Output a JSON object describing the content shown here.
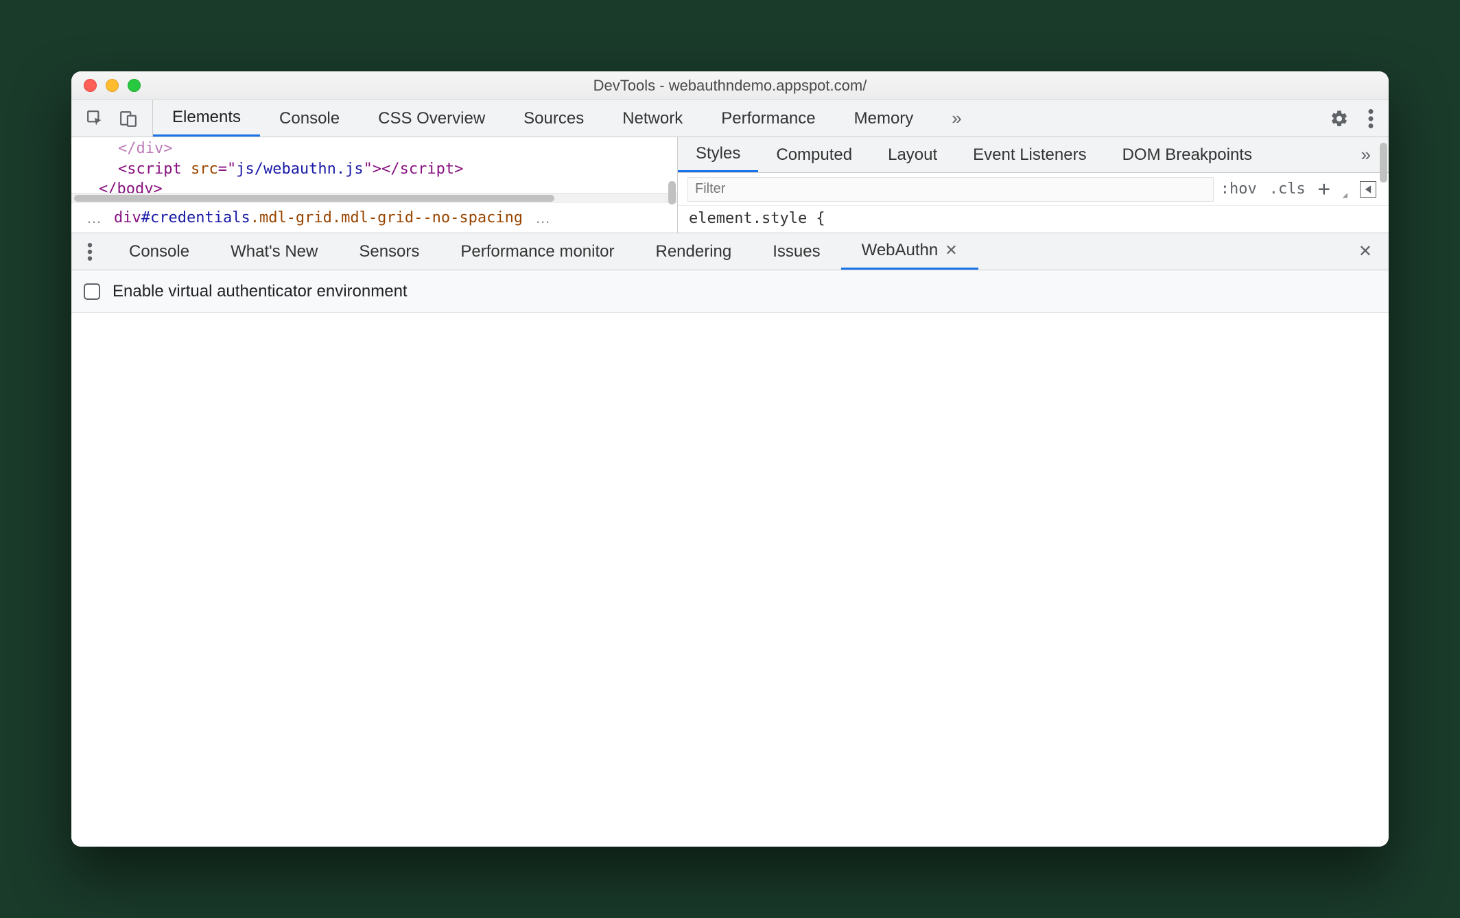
{
  "window": {
    "title": "DevTools - webauthndemo.appspot.com/"
  },
  "main_tabs": {
    "items": [
      "Elements",
      "Console",
      "CSS Overview",
      "Sources",
      "Network",
      "Performance",
      "Memory"
    ],
    "active": "Elements"
  },
  "elements": {
    "code_lines": [
      {
        "parts": [
          {
            "t": "</",
            "c": "tag"
          },
          {
            "t": "div",
            "c": "tag"
          },
          {
            "t": ">",
            "c": "tag"
          }
        ],
        "dim": true,
        "indent": 2
      },
      {
        "parts": [
          {
            "t": "<",
            "c": "tag"
          },
          {
            "t": "script ",
            "c": "tag"
          },
          {
            "t": "src",
            "c": "attr"
          },
          {
            "t": "=\"",
            "c": "tag"
          },
          {
            "t": "js/webauthn.js",
            "c": "str"
          },
          {
            "t": "\">",
            "c": "tag"
          },
          {
            "t": "</",
            "c": "tag"
          },
          {
            "t": "script",
            "c": "tag"
          },
          {
            "t": ">",
            "c": "tag"
          }
        ],
        "indent": 2
      },
      {
        "parts": [
          {
            "t": "</",
            "c": "tag"
          },
          {
            "t": "body",
            "c": "tag"
          },
          {
            "t": ">",
            "c": "tag"
          }
        ],
        "indent": 1
      }
    ],
    "breadcrumb": {
      "prefix": "…",
      "selector": {
        "tag": "div",
        "id": "#credentials",
        "classes": ".mdl-grid.mdl-grid--no-spacing"
      },
      "suffix": "…"
    }
  },
  "styles": {
    "tabs": [
      "Styles",
      "Computed",
      "Layout",
      "Event Listeners",
      "DOM Breakpoints"
    ],
    "active": "Styles",
    "filter_placeholder": "Filter",
    "tools": {
      "hov": ":hov",
      "cls": ".cls"
    },
    "body": "element.style {"
  },
  "drawer": {
    "tabs": [
      "Console",
      "What's New",
      "Sensors",
      "Performance monitor",
      "Rendering",
      "Issues",
      "WebAuthn"
    ],
    "active": "WebAuthn",
    "checkbox_label": "Enable virtual authenticator environment"
  }
}
